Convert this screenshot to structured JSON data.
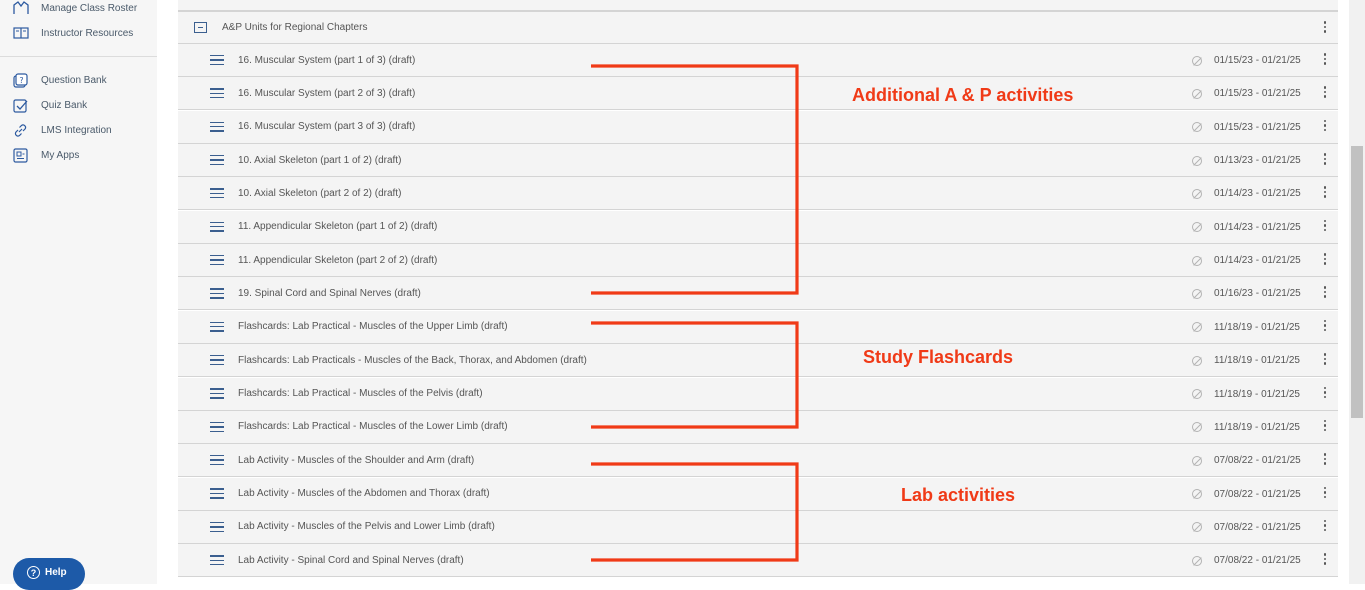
{
  "sidebar": {
    "items": [
      {
        "label": "Manage Class Roster",
        "icon": "roster-icon"
      },
      {
        "label": "Instructor Resources",
        "icon": "book-icon"
      },
      {
        "label": "Question Bank",
        "icon": "question-bank-icon"
      },
      {
        "label": "Quiz Bank",
        "icon": "checkbox-icon"
      },
      {
        "label": "LMS Integration",
        "icon": "link-icon"
      },
      {
        "label": "My Apps",
        "icon": "apps-icon"
      }
    ],
    "help_label": "Help"
  },
  "folder": {
    "title": "A&P Units for Regional Chapters"
  },
  "rows": [
    {
      "title": "16. Muscular System (part 1 of 3) (draft)",
      "dates": "01/15/23 - 01/21/25"
    },
    {
      "title": "16. Muscular System (part 2 of 3) (draft)",
      "dates": "01/15/23 - 01/21/25"
    },
    {
      "title": "16. Muscular System (part 3 of 3) (draft)",
      "dates": "01/15/23 - 01/21/25"
    },
    {
      "title": "10. Axial Skeleton (part 1 of 2) (draft)",
      "dates": "01/13/23 - 01/21/25"
    },
    {
      "title": "10. Axial Skeleton (part 2 of 2) (draft)",
      "dates": "01/14/23 - 01/21/25"
    },
    {
      "title": "11. Appendicular Skeleton (part 1 of 2) (draft)",
      "dates": "01/14/23 - 01/21/25"
    },
    {
      "title": "11. Appendicular Skeleton (part 2 of 2) (draft)",
      "dates": "01/14/23 - 01/21/25"
    },
    {
      "title": "19. Spinal Cord and Spinal Nerves (draft)",
      "dates": "01/16/23 - 01/21/25"
    },
    {
      "title": "Flashcards: Lab Practical - Muscles of the Upper Limb (draft)",
      "dates": "11/18/19 - 01/21/25"
    },
    {
      "title": "Flashcards: Lab Practicals - Muscles of the Back, Thorax, and Abdomen (draft)",
      "dates": "11/18/19 - 01/21/25"
    },
    {
      "title": "Flashcards: Lab Practical - Muscles of the Pelvis (draft)",
      "dates": "11/18/19 - 01/21/25"
    },
    {
      "title": "Flashcards: Lab Practical - Muscles of the Lower Limb (draft)",
      "dates": "11/18/19 - 01/21/25"
    },
    {
      "title": "Lab Activity - Muscles of the Shoulder and Arm (draft)",
      "dates": "07/08/22 - 01/21/25"
    },
    {
      "title": "Lab Activity - Muscles of the Abdomen and Thorax (draft)",
      "dates": "07/08/22 - 01/21/25"
    },
    {
      "title": "Lab Activity - Muscles of the Pelvis and Lower Limb (draft)",
      "dates": "07/08/22 - 01/21/25"
    },
    {
      "title": "Lab Activity - Spinal Cord and Spinal Nerves (draft)",
      "dates": "07/08/22 - 01/21/25"
    }
  ],
  "annotations": [
    {
      "label": "Additional A & P activities"
    },
    {
      "label": "Study Flashcards"
    },
    {
      "label": "Lab activities"
    }
  ],
  "colors": {
    "annotation": "#f03a17",
    "help_button": "#1d5aa8",
    "row_bg": "#f4f4f4"
  }
}
